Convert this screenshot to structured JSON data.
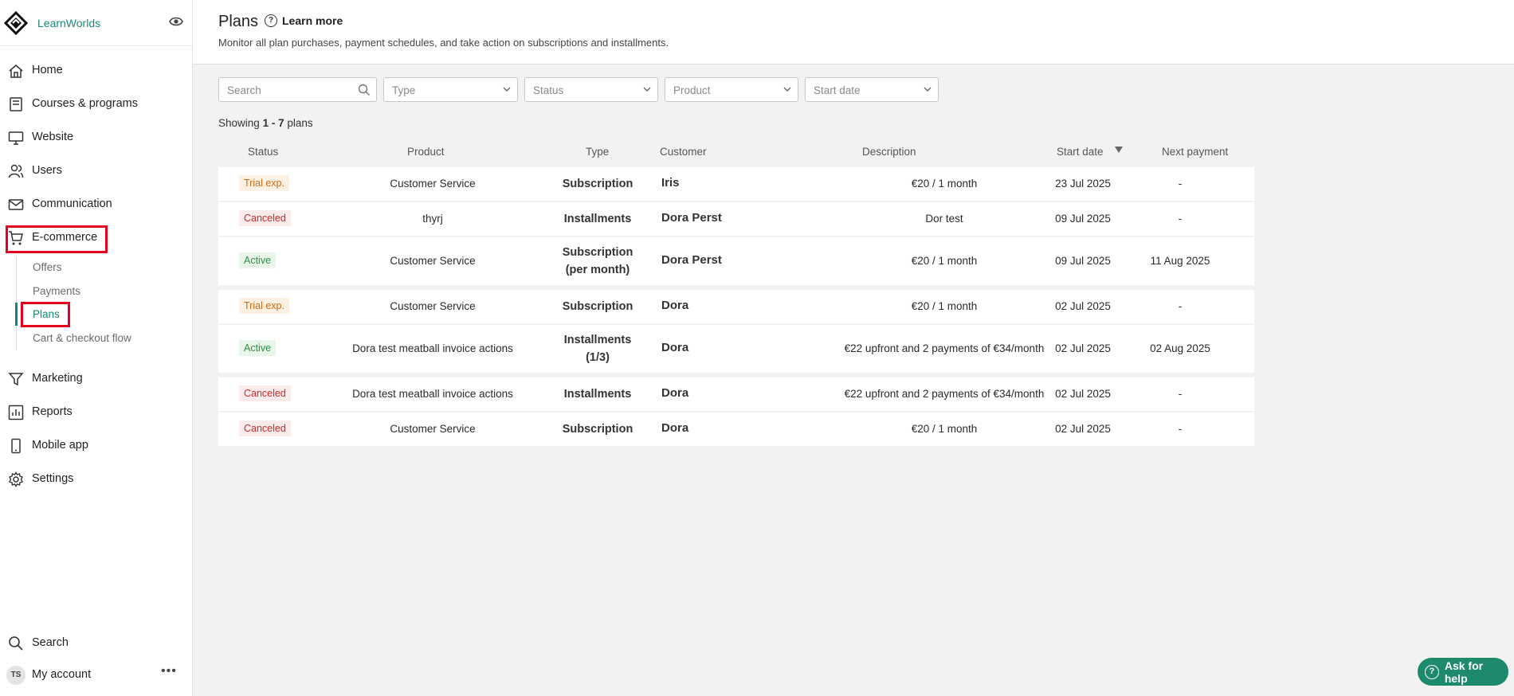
{
  "brand": {
    "name": "LearnWorlds"
  },
  "sidebar": {
    "items": [
      {
        "label": "Home",
        "icon": "home-icon"
      },
      {
        "label": "Courses & programs",
        "icon": "book-icon"
      },
      {
        "label": "Website",
        "icon": "monitor-icon"
      },
      {
        "label": "Users",
        "icon": "users-icon"
      },
      {
        "label": "Communication",
        "icon": "mail-icon"
      },
      {
        "label": "E-commerce",
        "icon": "cart-icon"
      },
      {
        "label": "Marketing",
        "icon": "funnel-icon"
      },
      {
        "label": "Reports",
        "icon": "chart-icon"
      },
      {
        "label": "Mobile app",
        "icon": "phone-icon"
      },
      {
        "label": "Settings",
        "icon": "gear-icon"
      }
    ],
    "ecommerce_sub": [
      "Offers",
      "Payments",
      "Plans",
      "Cart & checkout flow"
    ],
    "search_label": "Search",
    "account_label": "My account",
    "avatar_initials": "TS"
  },
  "header": {
    "title": "Plans",
    "learn_more": "Learn more",
    "subtitle": "Monitor all plan purchases, payment schedules, and take action on subscriptions and installments."
  },
  "filters": {
    "search_placeholder": "Search",
    "type": "Type",
    "status": "Status",
    "product": "Product",
    "start_date": "Start date"
  },
  "showing": {
    "prefix": "Showing",
    "range": "1 - 7",
    "suffix": "plans"
  },
  "table": {
    "columns": [
      "Status",
      "Product",
      "Type",
      "Customer",
      "Description",
      "Start date",
      "Next payment"
    ],
    "rows": [
      {
        "status": "Trial exp.",
        "status_kind": "trial",
        "product": "Customer Service",
        "type_line1": "Subscription",
        "type_line2": "",
        "customer": "Iris",
        "description": "€20 / 1 month",
        "start": "23 Jul 2025",
        "next": "-"
      },
      {
        "status": "Canceled",
        "status_kind": "canceled",
        "product": "thyrj",
        "type_line1": "Installments",
        "type_line2": "",
        "customer": "Dora Perst",
        "description": "Dor test",
        "start": "09 Jul 2025",
        "next": "-"
      },
      {
        "status": "Active",
        "status_kind": "active",
        "product": "Customer Service",
        "type_line1": "Subscription",
        "type_line2": "(per month)",
        "customer": "Dora Perst",
        "description": "€20 / 1 month",
        "start": "09 Jul 2025",
        "next": "11 Aug 2025"
      },
      {
        "status": "Trial exp.",
        "status_kind": "trial",
        "product": "Customer Service",
        "type_line1": "Subscription",
        "type_line2": "",
        "customer": "Dora",
        "description": "€20 / 1 month",
        "start": "02 Jul 2025",
        "next": "-"
      },
      {
        "status": "Active",
        "status_kind": "active",
        "product": "Dora test meatball invoice actions",
        "type_line1": "Installments",
        "type_line2": "(1/3)",
        "customer": "Dora",
        "description": "€22 upfront and 2 payments of €34/month",
        "start": "02 Jul 2025",
        "next": "02 Aug 2025"
      },
      {
        "status": "Canceled",
        "status_kind": "canceled",
        "product": "Dora test meatball invoice actions",
        "type_line1": "Installments",
        "type_line2": "",
        "customer": "Dora",
        "description": "€22 upfront and 2 payments of €34/month",
        "start": "02 Jul 2025",
        "next": "-"
      },
      {
        "status": "Canceled",
        "status_kind": "canceled",
        "product": "Customer Service",
        "type_line1": "Subscription",
        "type_line2": "",
        "customer": "Dora",
        "description": "€20 / 1 month",
        "start": "02 Jul 2025",
        "next": "-"
      }
    ]
  },
  "help": {
    "label": "Ask for help"
  },
  "colors": {
    "accent": "#0d8a74",
    "highlight": "#e5001c",
    "help": "#1d8a6e"
  }
}
